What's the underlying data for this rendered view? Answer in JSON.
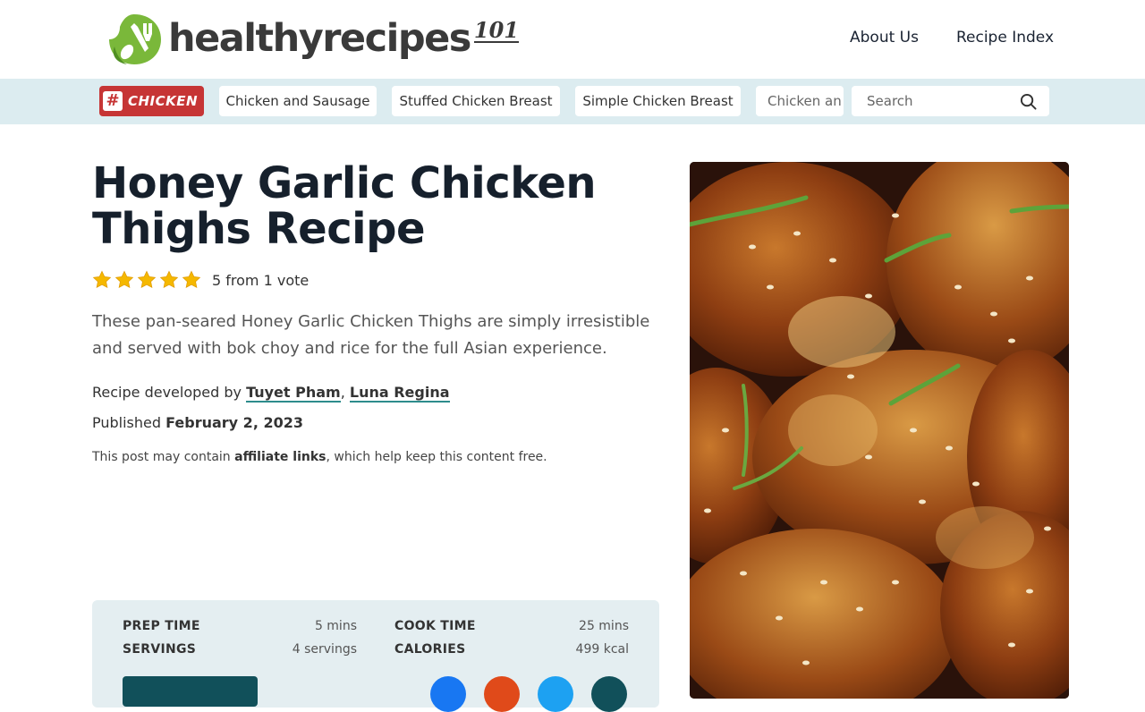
{
  "header": {
    "logo_text": "healthyrecipes",
    "logo_sup": "101",
    "nav": [
      "About Us",
      "Recipe Index"
    ]
  },
  "tagbar": {
    "badge_hash": "#",
    "badge_label": "CHICKEN",
    "chips": [
      "Chicken and Sausage",
      "Stuffed Chicken Breast",
      "Simple Chicken Breast",
      "Chicken an"
    ],
    "search_placeholder": "Search"
  },
  "article": {
    "title": "Honey Garlic Chicken Thighs Recipe",
    "rating_value": 5,
    "rating_text": "5 from 1 vote",
    "description": "These pan-seared Honey Garlic Chicken Thighs are simply irresistible and served with bok choy and rice for the full Asian experience.",
    "byline_prefix": "Recipe developed by ",
    "authors": [
      "Tuyet Pham",
      "Luna Regina"
    ],
    "published_prefix": "Published ",
    "published_date": "February 2, 2023",
    "disclosure_prefix": "This post may contain ",
    "disclosure_link": "affiliate links",
    "disclosure_suffix": ", which help keep this content free."
  },
  "recipe_card": {
    "prep_time_label": "PREP TIME",
    "prep_time_value": "5 mins",
    "cook_time_label": "COOK TIME",
    "cook_time_value": "25 mins",
    "servings_label": "SERVINGS",
    "servings_value": "4 servings",
    "calories_label": "CALORIES",
    "calories_value": "499 kcal"
  },
  "colors": {
    "tagbar_bg": "#dcecf0",
    "badge_red": "#c63535",
    "card_bg": "#e4eef1",
    "button_teal": "#11505a",
    "link_underline": "#2d8c8c",
    "star_gold": "#f5b800"
  },
  "icons": {
    "search": "search-icon",
    "star": "star-icon",
    "logo": "leaf-fork-spoon-logo-icon"
  }
}
